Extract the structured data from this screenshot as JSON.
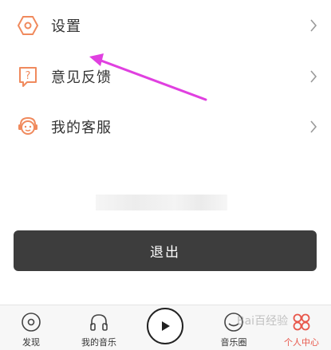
{
  "menu": {
    "items": [
      {
        "label": "设置",
        "icon": "hexagon-settings-icon"
      },
      {
        "label": "意见反馈",
        "icon": "question-bubble-icon"
      },
      {
        "label": "我的客服",
        "icon": "customer-service-avatar-icon"
      }
    ]
  },
  "logout": {
    "label": "退出"
  },
  "tabbar": {
    "tabs": [
      {
        "label": "发现",
        "icon": "disc-icon"
      },
      {
        "label": "我的音乐",
        "icon": "headphones-icon"
      },
      {
        "label": "",
        "icon": "play-icon"
      },
      {
        "label": "音乐圈",
        "icon": "music-circle-icon"
      },
      {
        "label": "个人中心",
        "icon": "profile-grid-icon",
        "active": true
      }
    ]
  },
  "watermark": {
    "text": "Bai百经验"
  },
  "colors": {
    "accent": "#e8574b",
    "icon_orange": "#f08a5d",
    "annotation_arrow": "#e040e0",
    "logout_bg": "#3d3d3d"
  }
}
